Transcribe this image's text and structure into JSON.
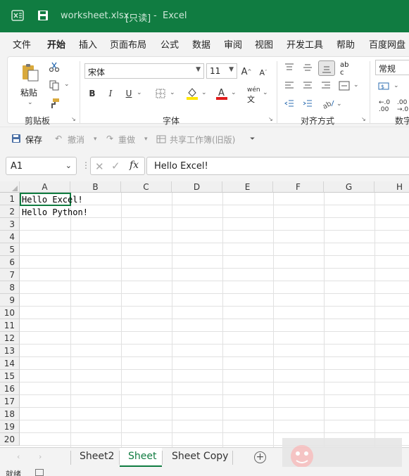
{
  "titlebar": {
    "filename": "worksheet.xlsx",
    "readonly": "[只读]",
    "app": "Excel"
  },
  "menu": {
    "tabs": [
      "文件",
      "开始",
      "插入",
      "页面布局",
      "公式",
      "数据",
      "审阅",
      "视图",
      "开发工具",
      "帮助",
      "百度网盘"
    ]
  },
  "ribbon": {
    "paste_label": "粘贴",
    "clipboard_group": "剪贴板",
    "font_name": "宋体",
    "font_size": "11",
    "font_group": "字体",
    "wen_label": "wén",
    "align_group": "对齐方式",
    "number_format": "常规",
    "number_group": "数字"
  },
  "qat": {
    "save": "保存",
    "undo": "撤消",
    "redo": "重做",
    "share": "共享工作簿(旧版)"
  },
  "formula": {
    "name_box": "A1",
    "fx": "fx",
    "content": "Hello Excel!"
  },
  "grid": {
    "columns": [
      "A",
      "B",
      "C",
      "D",
      "E",
      "F",
      "G",
      "H"
    ],
    "rows": [
      "1",
      "2",
      "3",
      "4",
      "5",
      "6",
      "7",
      "8",
      "9",
      "10",
      "11",
      "12",
      "13",
      "14",
      "15",
      "16",
      "17",
      "18",
      "19",
      "20"
    ],
    "cells": {
      "A1": "Hello Excel!",
      "A2": "Hello Python!"
    }
  },
  "sheets": {
    "tabs": [
      "Sheet2",
      "Sheet",
      "Sheet Copy"
    ],
    "active": "Sheet"
  },
  "status": {
    "ready": "就绪"
  },
  "colors": {
    "accent": "#107c41"
  }
}
